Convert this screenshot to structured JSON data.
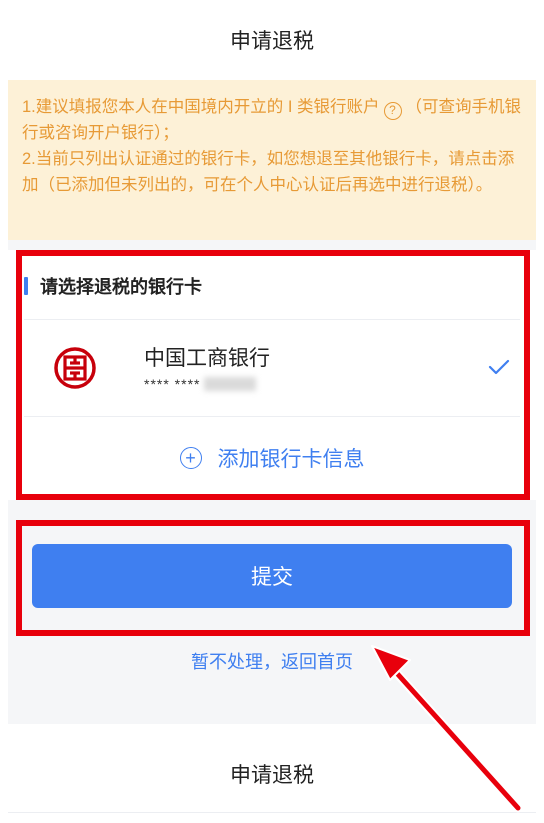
{
  "header": {
    "title": "申请退税"
  },
  "notice": {
    "line1_pre": "1.建议填报您本人在中国境内开立的 I 类银行账户",
    "help_icon": "?",
    "line1_post": "（可查询手机银行或咨询开户银行）；",
    "line2": "2.当前只列出认证通过的银行卡，如您想退至其他银行卡，请点击添加（已添加但未列出的，可在个人中心认证后再选中进行退税）。"
  },
  "bank_section": {
    "title": "请选择退税的银行卡",
    "selected_card": {
      "bank_name": "中国工商银行",
      "masked_number": "**** ****",
      "selected": true
    },
    "add_label": "添加银行卡信息",
    "add_icon": "+"
  },
  "actions": {
    "submit_label": "提交",
    "back_label": "暂不处理，返回首页"
  },
  "bottom_header": {
    "title": "申请退税"
  },
  "colors": {
    "accent": "#3f7ff0",
    "notice_bg": "#fdf1d7",
    "notice_text": "#e79a36",
    "highlight": "#e8000c",
    "icbc_red": "#c7000b"
  },
  "icons": [
    "icbc-logo",
    "check-icon",
    "plus-circle-icon",
    "help-circle-icon",
    "annotation-arrow"
  ]
}
